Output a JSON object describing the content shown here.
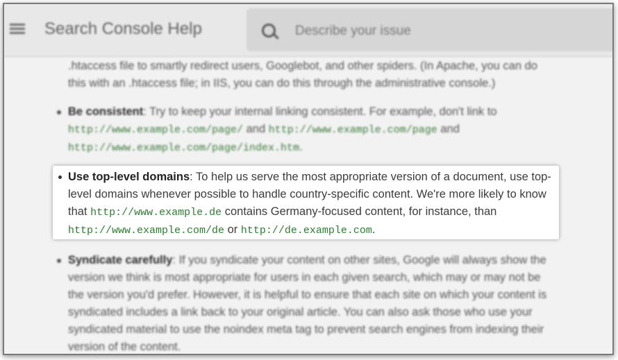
{
  "header": {
    "title": "Search Console Help",
    "search_placeholder": "Describe your issue"
  },
  "content": {
    "top_paragraph": ".htaccess file to smartly redirect users, Googlebot, and other spiders. (In Apache, you can do this with an .htaccess file; in IIS, you can do this through the administrative console.)",
    "consistent": {
      "title": "Be consistent",
      "text1": ": Try to keep your internal linking consistent. For example, don't link to ",
      "url1": "http://www.example.com/page/",
      "and1": " and ",
      "url2": "http://www.example.com/page",
      "and2": " and ",
      "url3": "http://www.example.com/page/index.htm",
      "end": "."
    },
    "toplevel": {
      "title": "Use top-level domains",
      "text1": ": To help us serve the most appropriate version of a document, use top-level domains whenever possible to handle country-specific content. We're more likely to know that ",
      "url1": "http://www.example.de",
      "text2": " contains Germany-focused content, for instance, than ",
      "url2": "http://www.example.com/de",
      "or": " or ",
      "url3": "http://de.example.com",
      "end": "."
    },
    "syndicate": {
      "title": "Syndicate carefully",
      "text": ": If you syndicate your content on other sites, Google will always show the version we think is most appropriate for users in each given search, which may or may not be the version you'd prefer. However, it is helpful to ensure that each site on which your content is syndicated includes a link back to your original article. You can also ask those who use your syndicated material to use the noindex meta tag to prevent search engines from indexing their version of the content."
    }
  },
  "colors": {
    "link_code": "#2e7d32",
    "overlay": "#f2f2f2"
  }
}
